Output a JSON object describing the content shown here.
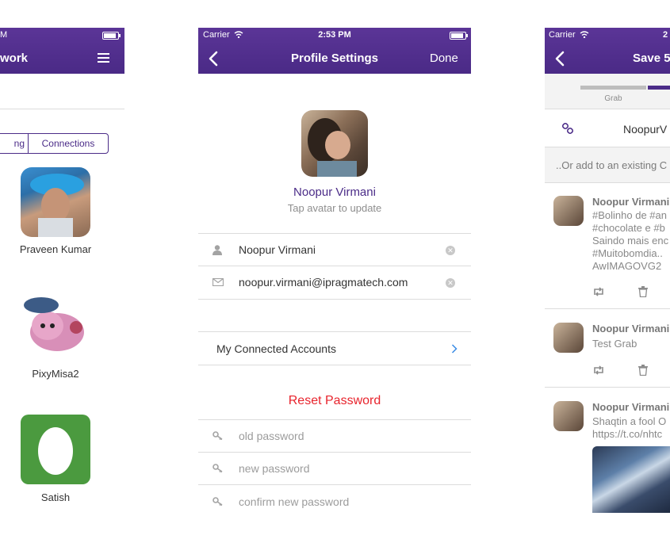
{
  "screen_left": {
    "status_time": "M",
    "nav_title": "work",
    "menu_icon": "hamburger-icon",
    "segments": [
      "ng",
      "Connections"
    ],
    "users": [
      {
        "name": "Praveen Kumar",
        "avatar": "photo"
      },
      {
        "name": "PixyMisa2",
        "avatar": "plush-toy"
      },
      {
        "name": "Satish",
        "avatar": "egg"
      }
    ],
    "colors": {
      "accent": "#4b2c88",
      "egg_bg": "#4b9a3f"
    }
  },
  "screen_middle": {
    "status": {
      "carrier": "Carrier",
      "time": "2:53 PM"
    },
    "nav": {
      "back_icon": "chevron-left-icon",
      "title": "Profile Settings",
      "done": "Done"
    },
    "profile": {
      "name": "Noopur Virmani",
      "hint": "Tap avatar to update"
    },
    "fields": {
      "name_value": "Noopur Virmani",
      "email_value": "noopur.virmani@ipragmatech.com"
    },
    "connected_accounts": "My Connected Accounts",
    "reset_password": {
      "title": "Reset Password",
      "old_placeholder": "old password",
      "new_placeholder": "new password",
      "confirm_placeholder": "confirm new password"
    },
    "colors": {
      "reset_red": "#e8242d",
      "name_purple": "#4b2c88"
    }
  },
  "screen_right": {
    "status": {
      "carrier": "Carrier",
      "time": "2"
    },
    "nav": {
      "back_icon": "chevron-left-icon",
      "title": "Save 5"
    },
    "progress_label": "Grab",
    "link_text": "NoopurV",
    "add_existing": "..Or add to an existing C",
    "tweets": [
      {
        "name": "Noopur Virmani",
        "body": "#Bolinho de #an\n#chocolate e #b\nSaindo mais enc\n#Muitobomdia..\nAwIMAGOVG2"
      },
      {
        "name": "Noopur Virmani",
        "body": "Test Grab"
      },
      {
        "name": "Noopur Virmani",
        "body": "Shaqtin a fool O\nhttps://t.co/nhtc"
      }
    ]
  }
}
